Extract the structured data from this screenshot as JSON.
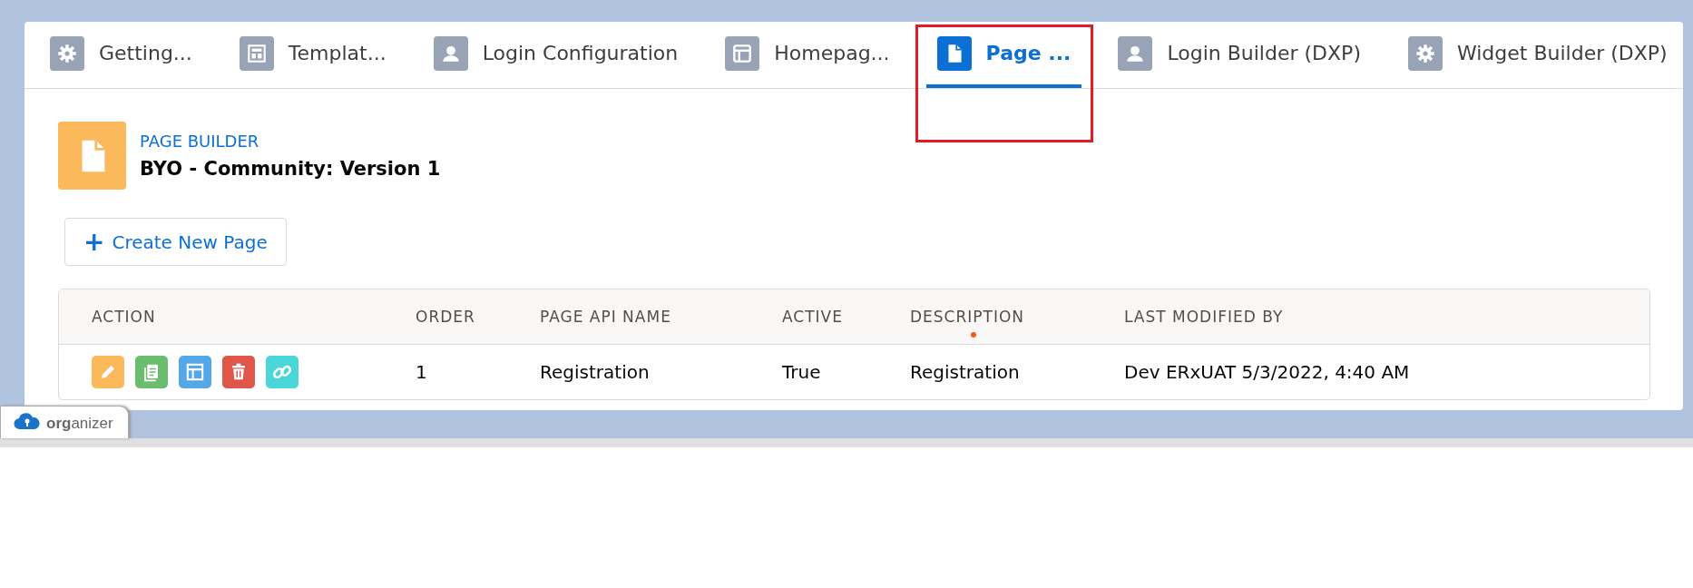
{
  "tabs": [
    {
      "label": "Getting...",
      "selected": false,
      "highlighted": false
    },
    {
      "label": "Templat...",
      "selected": false,
      "highlighted": false
    },
    {
      "label": "Login Configuration",
      "selected": false,
      "highlighted": false
    },
    {
      "label": "Homepag...",
      "selected": false,
      "highlighted": false
    },
    {
      "label": "Page ...",
      "selected": true,
      "highlighted": true
    },
    {
      "label": "Login Builder (DXP)",
      "selected": false,
      "highlighted": false
    },
    {
      "label": "Widget Builder (DXP)",
      "selected": false,
      "highlighted": false
    }
  ],
  "header": {
    "eyebrow": "PAGE BUILDER",
    "title": "BYO - Community: Version 1"
  },
  "create_button": {
    "icon": "+",
    "label": "Create New Page"
  },
  "table": {
    "columns": [
      {
        "label": "ACTION",
        "marked": false
      },
      {
        "label": "ORDER",
        "marked": false
      },
      {
        "label": "PAGE API NAME",
        "marked": false
      },
      {
        "label": "ACTIVE",
        "marked": false
      },
      {
        "label": "DESCRIPTION",
        "marked": true
      },
      {
        "label": "LAST MODIFIED BY",
        "marked": false
      }
    ],
    "rows": [
      {
        "actions": [
          {
            "kind": "edit",
            "color": "#fcb95b"
          },
          {
            "kind": "copy",
            "color": "#6bbd6e"
          },
          {
            "kind": "layout",
            "color": "#54a8e8"
          },
          {
            "kind": "delete",
            "color": "#e0574a"
          },
          {
            "kind": "link",
            "color": "#4bd6d9"
          }
        ],
        "cells": [
          "",
          "1",
          "Registration",
          "True",
          "Registration",
          "Dev ERxUAT 5/3/2022, 4:40 AM"
        ]
      }
    ]
  },
  "footer_tab": {
    "label": "**org**anizer"
  }
}
